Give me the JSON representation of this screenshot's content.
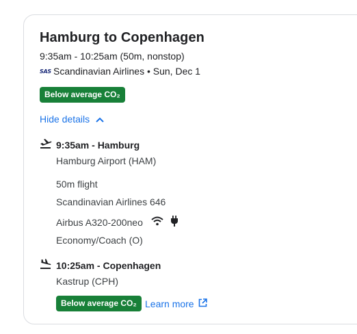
{
  "flight": {
    "title": "Hamburg to Copenhagen",
    "times_summary": "9:35am - 10:25am (50m, nonstop)",
    "airline_logo_text": "SAS",
    "airline_date": "Scandinavian Airlines • Sun, Dec 1",
    "co2_badge": "Below average CO₂",
    "hide_details": "Hide details"
  },
  "segment": {
    "departure_time": "9:35am - Hamburg",
    "departure_airport": "Hamburg Airport (HAM)",
    "duration": "50m flight",
    "flight_number": "Scandinavian Airlines 646",
    "aircraft": "Airbus A320-200neo",
    "cabin": "Economy/Coach (O)",
    "arrival_time": "10:25am - Copenhagen",
    "arrival_airport": "Kastrup (CPH)",
    "co2_badge": "Below average CO₂",
    "learn_more": "Learn more"
  },
  "icons": {
    "departure": "takeoff-icon",
    "arrival": "landing-icon",
    "wifi": "wifi-icon",
    "power": "power-plug-icon",
    "expand": "chevron-up-icon",
    "external": "external-link-icon"
  },
  "colors": {
    "badge_green": "#188038",
    "link_blue": "#1a73e8",
    "border": "#dadce0"
  }
}
